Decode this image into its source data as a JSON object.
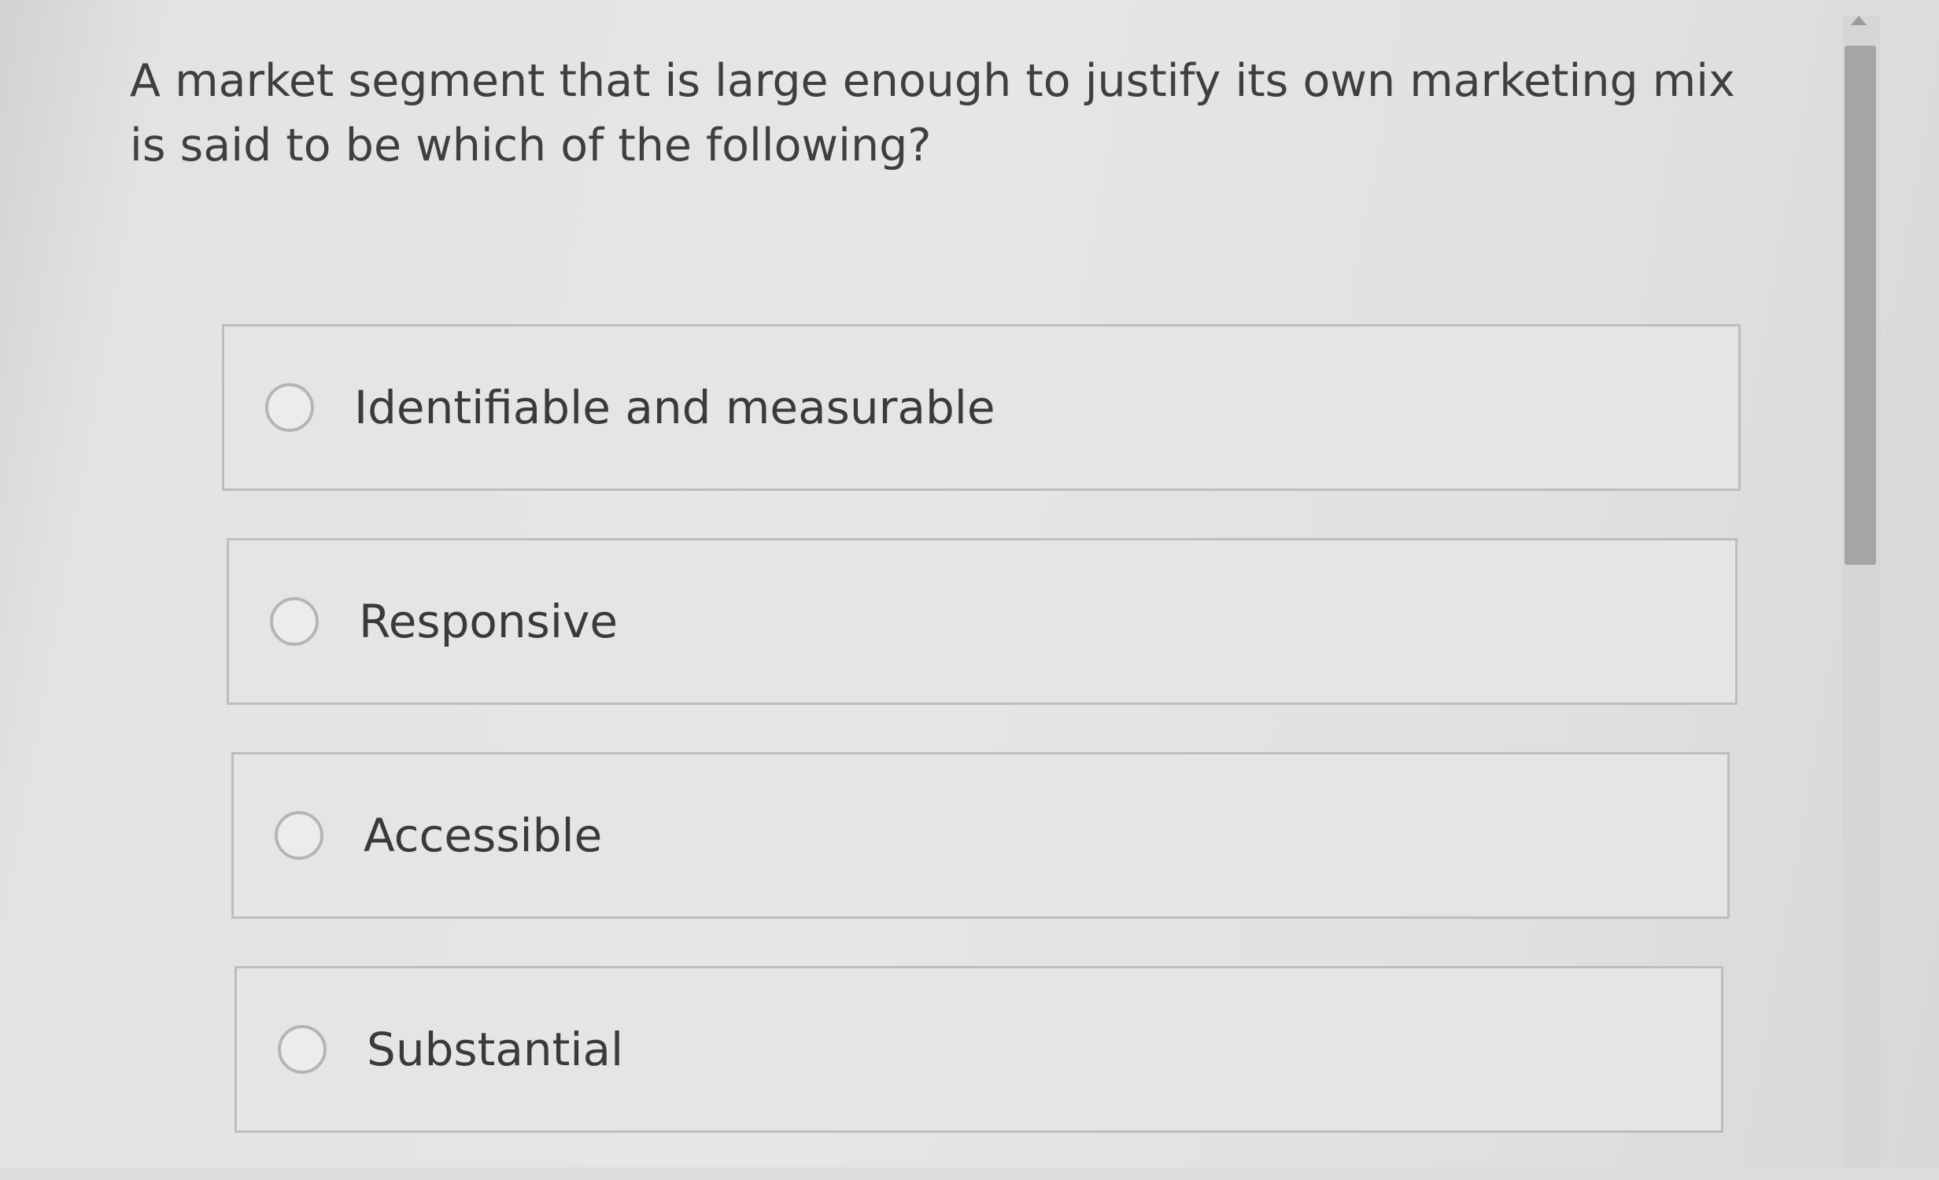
{
  "question": {
    "text": "A market segment that is large enough to justify its own marketing mix is said to be which of the following?"
  },
  "options": [
    {
      "label": "Identifiable and measurable",
      "selected": false
    },
    {
      "label": "Responsive",
      "selected": false
    },
    {
      "label": "Accessible",
      "selected": false
    },
    {
      "label": "Substantial",
      "selected": false
    }
  ],
  "scrollbar": {
    "position": 0
  }
}
